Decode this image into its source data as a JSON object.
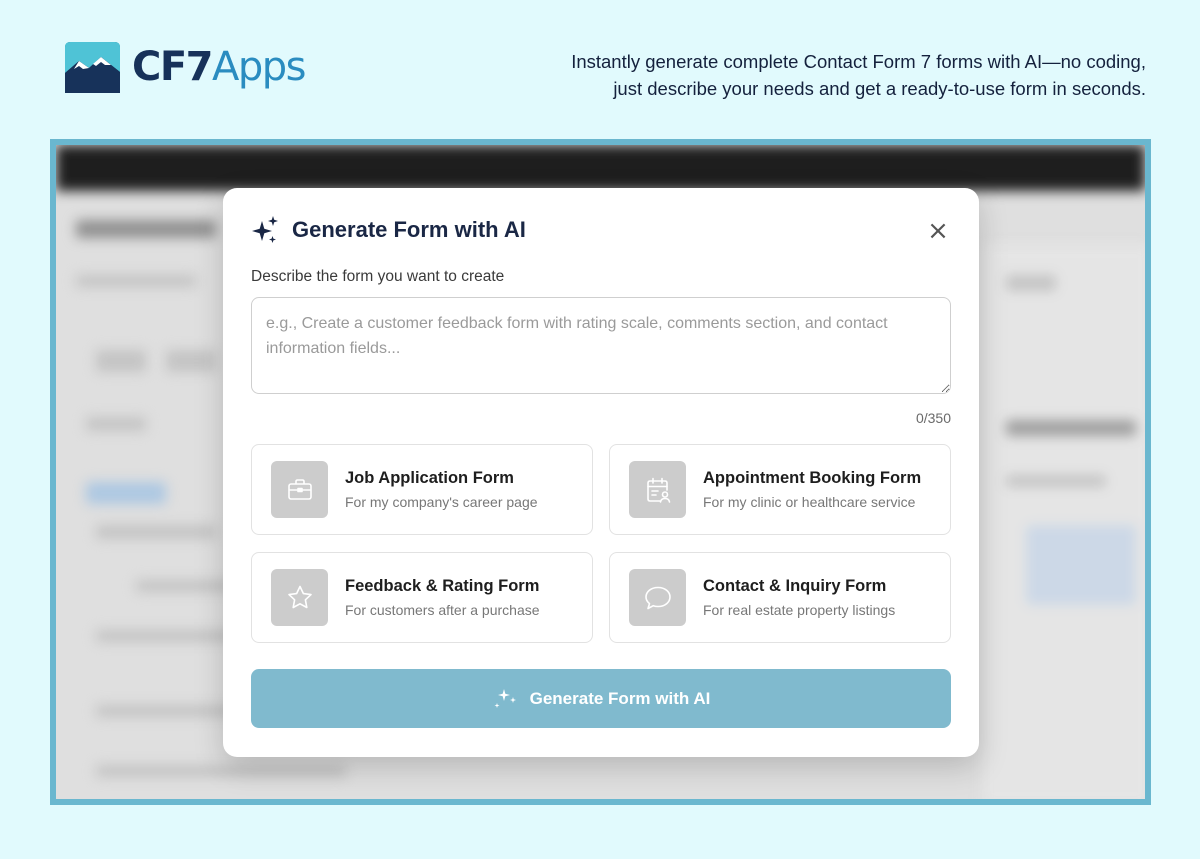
{
  "brand": {
    "name_part1": "CF7",
    "name_part2": "Apps",
    "logo_icon": "mountain-logo-icon",
    "colors": {
      "dark": "#17325a",
      "accent": "#2a8cc0",
      "teal": "#4fc3d6"
    }
  },
  "tagline": {
    "line1": "Instantly generate complete Contact Form 7 forms with AI—no coding,",
    "line2": "just describe your needs and get a ready-to-use form in seconds."
  },
  "modal": {
    "title": "Generate Form with AI",
    "title_icon": "sparkle-icon",
    "close_icon": "close-icon",
    "close_label": "×",
    "field_label": "Describe the form you want to create",
    "textarea": {
      "value": "",
      "placeholder": "e.g., Create a customer feedback form with rating scale, comments section, and contact information fields..."
    },
    "char_count": "0/350",
    "templates": [
      {
        "title": "Job Application Form",
        "description": "For my company's career page",
        "icon": "briefcase-icon"
      },
      {
        "title": "Appointment Booking Form",
        "description": "For my clinic or healthcare service",
        "icon": "calendar-user-icon"
      },
      {
        "title": "Feedback & Rating Form",
        "description": "For customers after a purchase",
        "icon": "star-icon"
      },
      {
        "title": "Contact & Inquiry Form",
        "description": "For real estate property listings",
        "icon": "chat-bubble-icon"
      }
    ],
    "generate_button": {
      "label": "Generate Form with AI",
      "icon": "sparkle-icon",
      "color": "#80bace"
    }
  },
  "colors": {
    "page_background": "#e1fafd",
    "frame_border": "#6ab7cf",
    "title_text": "#1a2745"
  }
}
